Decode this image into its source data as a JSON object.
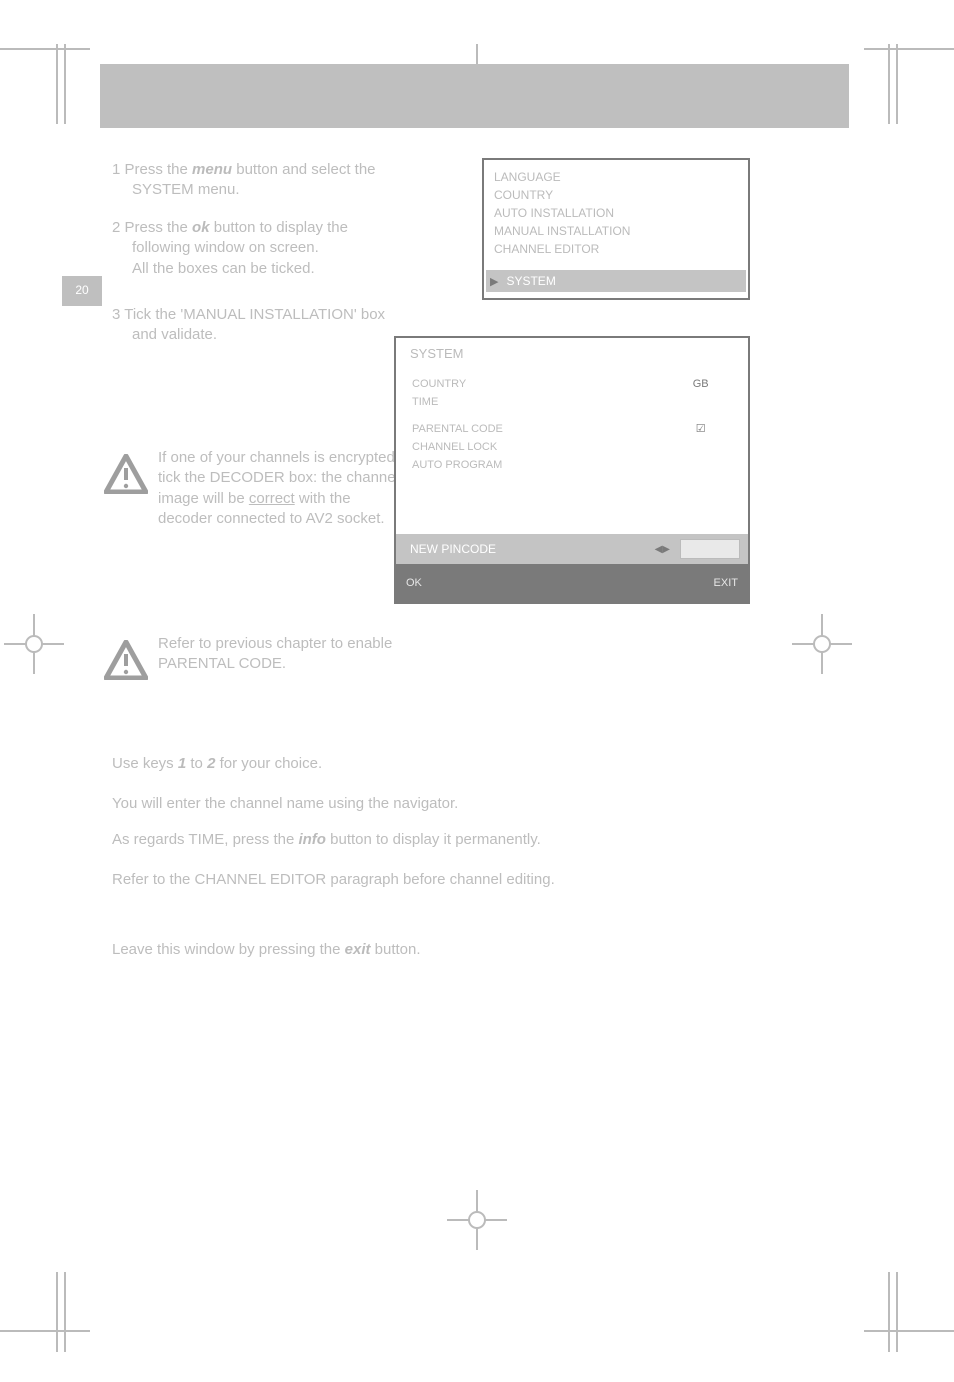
{
  "page_tab": "20",
  "step1": {
    "line1_pre": "1  Press the ",
    "line1_kw": "menu",
    "line1_post": " button and select the",
    "line2": "SYSTEM menu."
  },
  "step2": {
    "line1_pre": "2  Press the ",
    "line1_kw": "ok",
    "line1_post": " button to display the",
    "line2": "following window on screen.",
    "line3": "All the boxes can be ticked."
  },
  "step3": {
    "line1": "3  Tick the 'MANUAL INSTALLATION' box",
    "line2": "and validate."
  },
  "warn1": {
    "line1": "If one of your channels is encrypted,",
    "line2": "tick the DECODER box: the channel",
    "line3_pre": "image will be ",
    "line3_uline": "correct",
    "line3_post": " with the",
    "line4": "decoder connected to AV2 socket."
  },
  "warn2": {
    "line1": "Refer to previous chapter to enable",
    "line2": "PARENTAL CODE."
  },
  "lines": {
    "A_pre": "Use keys ",
    "A_k1": "1",
    "A_mid": " to ",
    "A_k2": "2",
    "A_post": " for your choice.",
    "B": "You will enter the channel name using the navigator.",
    "C_pre": "As regards TIME, press the ",
    "C_kw": "info",
    "C_post": " button to display it permanently.",
    "D": "Refer to the CHANNEL EDITOR paragraph before channel editing.",
    "E_pre": "Leave this window by pressing the ",
    "E_kw": "exit",
    "E_post": " button."
  },
  "box1": {
    "rows": [
      "LANGUAGE",
      "COUNTRY",
      "AUTO INSTALLATION",
      "MANUAL INSTALLATION",
      "CHANNEL EDITOR"
    ],
    "highlight": "SYSTEM"
  },
  "box2": {
    "title": "SYSTEM",
    "rows": [
      {
        "label": "COUNTRY",
        "value": "GB"
      },
      {
        "label": "TIME",
        "value": ""
      },
      {
        "label": "PARENTAL CODE",
        "value": "☑"
      },
      {
        "label": "CHANNEL LOCK",
        "value": ""
      },
      {
        "label": "AUTO PROGRAM",
        "value": ""
      }
    ],
    "pin_label": "NEW PINCODE",
    "foot_left": "OK",
    "foot_right": "EXIT"
  }
}
